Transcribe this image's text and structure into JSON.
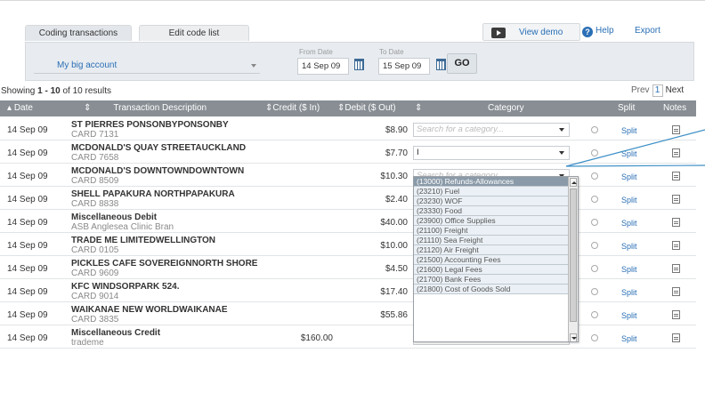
{
  "tabs": [
    {
      "label": "Coding transactions",
      "active": true
    },
    {
      "label": "Edit code list",
      "active": false
    }
  ],
  "toolbar": {
    "view_demo": "View demo",
    "help": "Help",
    "export": "Export"
  },
  "filter": {
    "account": "My big account",
    "from_label": "From Date",
    "from_value": "14 Sep 09",
    "to_label": "To Date",
    "to_value": "15 Sep 09",
    "go": "GO"
  },
  "results": {
    "prefix": "Showing ",
    "range": "1 - 10",
    "middle": " of 10 results"
  },
  "pager": {
    "prev": "Prev",
    "page": "1",
    "next": "Next"
  },
  "columns": {
    "date": "Date",
    "description": "Transaction Description",
    "credit": "Credit ($ In)",
    "debit": "Debit ($ Out)",
    "category": "Category",
    "split": "Split",
    "notes": "Notes"
  },
  "category_placeholder": "Search for a category...",
  "split_label": "Split",
  "rows": [
    {
      "date": "14 Sep 09",
      "desc": "ST PIERRES PONSONBYPONSONBY",
      "sub": "CARD 7131",
      "credit": "",
      "debit": "$8.90",
      "category": ""
    },
    {
      "date": "14 Sep 09",
      "desc": "MCDONALD'S QUAY STREETAUCKLAND",
      "sub": "CARD 7658",
      "credit": "",
      "debit": "$7.70",
      "category": "I"
    },
    {
      "date": "14 Sep 09",
      "desc": "MCDONALD'S DOWNTOWNDOWNTOWN",
      "sub": "CARD 8509",
      "credit": "",
      "debit": "$10.30",
      "category": ""
    },
    {
      "date": "14 Sep 09",
      "desc": "SHELL PAPAKURA NORTHPAPAKURA",
      "sub": "CARD 8838",
      "credit": "",
      "debit": "$2.40",
      "category": ""
    },
    {
      "date": "14 Sep 09",
      "desc": "Miscellaneous Debit",
      "sub": "ASB Anglesea Clinic Bran",
      "credit": "",
      "debit": "$40.00",
      "category": ""
    },
    {
      "date": "14 Sep 09",
      "desc": "TRADE ME LIMITEDWELLINGTON",
      "sub": "CARD 0105",
      "credit": "",
      "debit": "$10.00",
      "category": ""
    },
    {
      "date": "14 Sep 09",
      "desc": "PICKLES CAFE SOVEREIGNNORTH SHORE",
      "sub": "CARD 9609",
      "credit": "",
      "debit": "$4.50",
      "category": ""
    },
    {
      "date": "14 Sep 09",
      "desc": "KFC WINDSORPARK 524.",
      "sub": "CARD 9014",
      "credit": "",
      "debit": "$17.40",
      "category": ""
    },
    {
      "date": "14 Sep 09",
      "desc": "WAIKANAE NEW WORLDWAIKANAE",
      "sub": "CARD 3835",
      "credit": "",
      "debit": "$55.86",
      "category": ""
    },
    {
      "date": "14 Sep 09",
      "desc": "Miscellaneous Credit",
      "sub": "trademe",
      "credit": "$160.00",
      "debit": "",
      "category": ""
    }
  ],
  "dropdown_options": [
    "(13000) Refunds-Allowances",
    "(23210) Fuel",
    "(23230) WOF",
    "(23330) Food",
    "(23900) Office Supplies",
    "(21100) Freight",
    "(21110) Sea Freight",
    "(21120) Air Freight",
    "(21500) Accounting Fees",
    "(21600) Legal Fees",
    "(21700) Bank Fees",
    "(21800) Cost of Goods Sold"
  ],
  "colors": {
    "header_bg": "#888e94",
    "link": "#2a6fb5",
    "filter_bg": "#e8ecf0",
    "callout": "#3d8fc6"
  }
}
